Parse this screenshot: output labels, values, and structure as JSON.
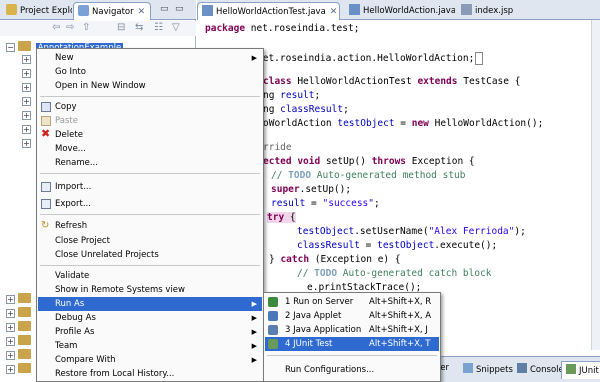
{
  "left_tabs": {
    "project_explorer": "Project Explo",
    "navigator": "Navigator"
  },
  "tree": {
    "selected_project": "AnnotationExample"
  },
  "editor_tabs": [
    {
      "label": "HelloWorldActionTest.java"
    },
    {
      "label": "HelloWorldAction.java"
    },
    {
      "label": "index.jsp"
    }
  ],
  "code": {
    "l1_kw": "package",
    "l1_rest": " net.roseindia.test;",
    "l2_rest": "net.roseindia.action.HelloWorldAction;",
    "l3_kw1": "class",
    "l3_mid": " HelloWorldActionTest ",
    "l3_kw2": "extends",
    "l3_rest": " TestCase {",
    "l4_pre": "ng ",
    "l4_fld": "result",
    "l4_end": ";",
    "l5_pre": "ng ",
    "l5_fld": "classResult",
    "l5_end": ";",
    "l6_pre": "oWorldAction ",
    "l6_fld": "testObject",
    "l6_mid": " = ",
    "l6_kw": "new",
    "l6_rest": " HelloWorldAction();",
    "l7_ann": "rride",
    "l8_kw": "ected void",
    "l8_mid": " setUp() ",
    "l8_kw2": "throws",
    "l8_rest": " Exception {",
    "l9_cmt": "// ",
    "l9_todo": "TODO",
    "l9_cmt2": " Auto-generated method stub",
    "l10_kw": "super",
    "l10_rest": ".setUp();",
    "l11_fld": "result",
    "l11_mid": " = ",
    "l11_str": "\"success\"",
    "l11_end": ";",
    "l12_kw": "try",
    "l12_rest": " {",
    "l13_fld": "testObject",
    "l13_mid": ".setUserName(",
    "l13_str": "\"Alex Ferrioda\"",
    "l13_end": ");",
    "l14_fld": "classResult",
    "l14_mid": " = ",
    "l14_fld2": "testObject",
    "l14_end": ".execute();",
    "l15_pre": "} ",
    "l15_kw": "catch",
    "l15_rest": " (Exception e) {",
    "l16_cmt": "// ",
    "l16_todo": "TODO",
    "l16_cmt2": " Auto-generated catch block",
    "l17_rest": "e.printStackTrace();",
    "l18_rest": "}"
  },
  "bottom_tabs": {
    "rer": "rer",
    "snippets": "Snippets",
    "console": "Console",
    "junit": "JUnit"
  },
  "context_menu": {
    "items": [
      {
        "label": "New"
      },
      {
        "label": "Go Into"
      },
      {
        "label": "Open in New Window"
      },
      {
        "label": "Copy"
      },
      {
        "label": "Paste"
      },
      {
        "label": "Delete"
      },
      {
        "label": "Move..."
      },
      {
        "label": "Rename..."
      },
      {
        "label": "Import..."
      },
      {
        "label": "Export..."
      },
      {
        "label": "Refresh"
      },
      {
        "label": "Close Project"
      },
      {
        "label": "Close Unrelated Projects"
      },
      {
        "label": "Validate"
      },
      {
        "label": "Show in Remote Systems view"
      },
      {
        "label": "Run As"
      },
      {
        "label": "Debug As"
      },
      {
        "label": "Profile As"
      },
      {
        "label": "Team"
      },
      {
        "label": "Compare With"
      },
      {
        "label": "Restore from Local History..."
      }
    ]
  },
  "run_as_submenu": {
    "items": [
      {
        "label": "1 Run on Server",
        "accel": "Alt+Shift+X, R"
      },
      {
        "label": "2 Java Applet",
        "accel": "Alt+Shift+X, A"
      },
      {
        "label": "3 Java Application",
        "accel": "Alt+Shift+X, J"
      },
      {
        "label": "4 JUnit Test",
        "accel": "Alt+Shift+X, T"
      },
      {
        "label": "Run Configurations..."
      }
    ]
  },
  "colors": {
    "highlight": "#2f6ad0",
    "keyword": "#7f0055",
    "field": "#0000c0",
    "string": "#2a00ff",
    "comment": "#3f7f5f"
  }
}
